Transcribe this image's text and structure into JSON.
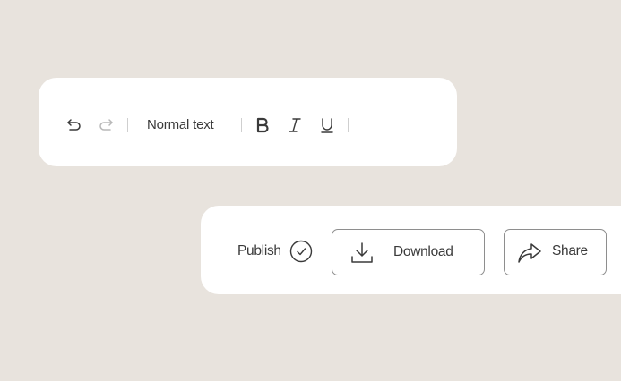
{
  "toolbar": {
    "undo_icon": "undo-icon",
    "redo_icon": "redo-icon",
    "text_style": "Normal text",
    "bold_icon": "bold-icon",
    "italic_icon": "italic-icon",
    "underline_icon": "underline-icon"
  },
  "actions": {
    "publish_label": "Publish",
    "publish_icon": "check-circle-icon",
    "download_label": "Download",
    "download_icon": "download-icon",
    "share_label": "Share",
    "share_icon": "share-arrow-icon"
  },
  "colors": {
    "background": "#e8e3dd",
    "card": "#ffffff",
    "icon": "#3a3a3a",
    "disabled_icon": "#b8b8b8",
    "border": "#8e8e8e"
  }
}
